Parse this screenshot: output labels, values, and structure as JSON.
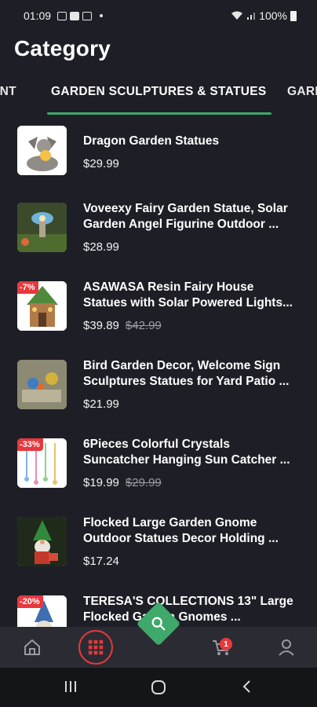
{
  "status_bar": {
    "time": "01:09",
    "battery": "100%"
  },
  "header": {
    "title": "Category"
  },
  "tabs": [
    {
      "label": "PAINT",
      "visible_label": "PAINT",
      "active": false
    },
    {
      "label": "GARDEN SCULPTURES & STATUES",
      "active": true
    },
    {
      "label": "GARD",
      "active": false
    }
  ],
  "products": [
    {
      "title_line1": "Dragon Garden Statues",
      "title_line2": "",
      "price": "$29.99",
      "old_price": "",
      "badge": ""
    },
    {
      "title_line1": "Voveexy Fairy Garden Statue, Solar",
      "title_line2": "Garden Angel Figurine Outdoor ...",
      "price": "$28.99",
      "old_price": "",
      "badge": ""
    },
    {
      "title_line1": "ASAWASA Resin Fairy House",
      "title_line2": "Statues with Solar Powered Lights...",
      "price": "$39.89",
      "old_price": "$42.99",
      "badge": "-7%"
    },
    {
      "title_line1": "Bird Garden Decor, Welcome Sign",
      "title_line2": "Sculptures Statues for Yard Patio ...",
      "price": "$21.99",
      "old_price": "",
      "badge": ""
    },
    {
      "title_line1": "6Pieces Colorful Crystals",
      "title_line2": "Suncatcher Hanging Sun Catcher ...",
      "price": "$19.99",
      "old_price": "$29.99",
      "badge": "-33%"
    },
    {
      "title_line1": "Flocked Large Garden Gnome",
      "title_line2": "Outdoor Statues Decor Holding ...",
      "price": "$17.24",
      "old_price": "",
      "badge": ""
    },
    {
      "title_line1": "TERESA'S COLLECTIONS 13\" Large",
      "title_line2": "Flocked Garden Gnomes ...",
      "price": "",
      "old_price": "",
      "badge": "-20%"
    }
  ],
  "bottom_nav": {
    "items": [
      "home-icon",
      "category-grid-icon",
      "search-icon",
      "cart-icon",
      "profile-icon"
    ],
    "cart_count": "1"
  },
  "colors": {
    "accent_green": "#3fa86b",
    "badge_red": "#e8383d",
    "background": "#1e1f26"
  }
}
